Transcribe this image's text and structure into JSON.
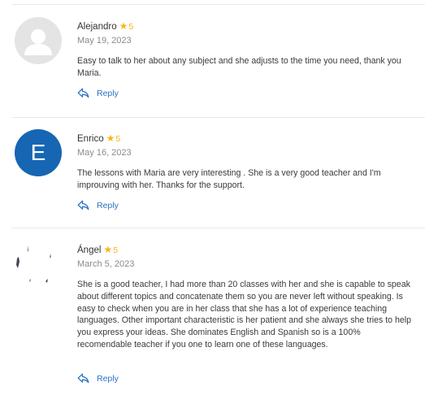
{
  "reviews": [
    {
      "name": "Alejandro",
      "rating": "5",
      "date": "May 19, 2023",
      "text": "Easy to talk to her about any subject and she adjusts to the time you need, thank you Maria.",
      "reply_label": "Reply",
      "avatar_type": "placeholder"
    },
    {
      "name": "Enrico",
      "rating": "5",
      "date": "May 16, 2023",
      "text": "The lessons with Maria are very interesting . She is a very good teacher and I'm improuving with her. Thanks for the support.",
      "reply_label": "Reply",
      "avatar_type": "letter",
      "avatar_letter": "E",
      "avatar_color": "#1666b3"
    },
    {
      "name": "Ángel",
      "rating": "5",
      "date": "March 5, 2023",
      "text": "She is a good teacher, I had more than 20 classes with her and she is capable to speak about different topics and concatenate them so you are never left without speaking. Is easy to check when you are in her class that she has a lot of experience teaching languages. Other important characteristic is her patient and she always she tries to help you express your ideas. She dominates English and Spanish so is a 100% recomendable teacher if you one to learn one of these languages.",
      "reply_label": "Reply",
      "avatar_type": "photo"
    }
  ],
  "colors": {
    "star": "#f5b619",
    "link": "#2a73c4",
    "divider": "#e9e9e9"
  },
  "icons": {
    "star": "star-icon",
    "reply": "reply-arrow-icon",
    "placeholder_avatar": "user-silhouette-icon"
  }
}
